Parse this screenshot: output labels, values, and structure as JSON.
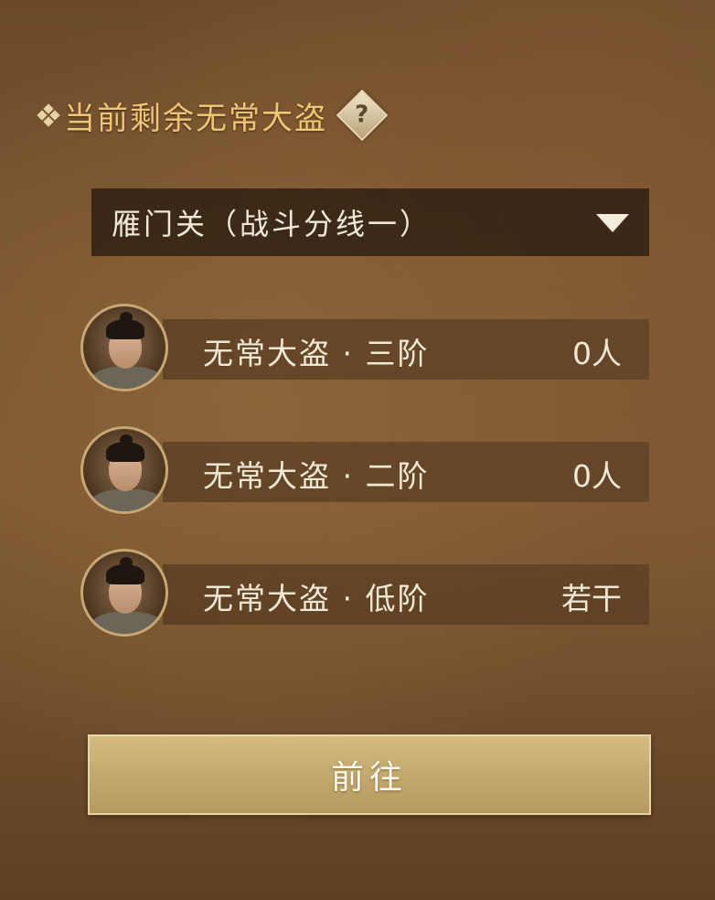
{
  "header": {
    "title": "当前剩余无常大盗",
    "help_icon": "?"
  },
  "server_select": {
    "value": "雁门关（战斗分线一）"
  },
  "enemies": [
    {
      "name": "无常大盗 · 三阶",
      "count": "0人"
    },
    {
      "name": "无常大盗 · 二阶",
      "count": "0人"
    },
    {
      "name": "无常大盗 · 低阶",
      "count": "若干"
    }
  ],
  "go_button": {
    "label": "前往"
  },
  "colors": {
    "title": "#f0c675",
    "button": "#c3a96e",
    "panel_bg": "#7a5632"
  }
}
